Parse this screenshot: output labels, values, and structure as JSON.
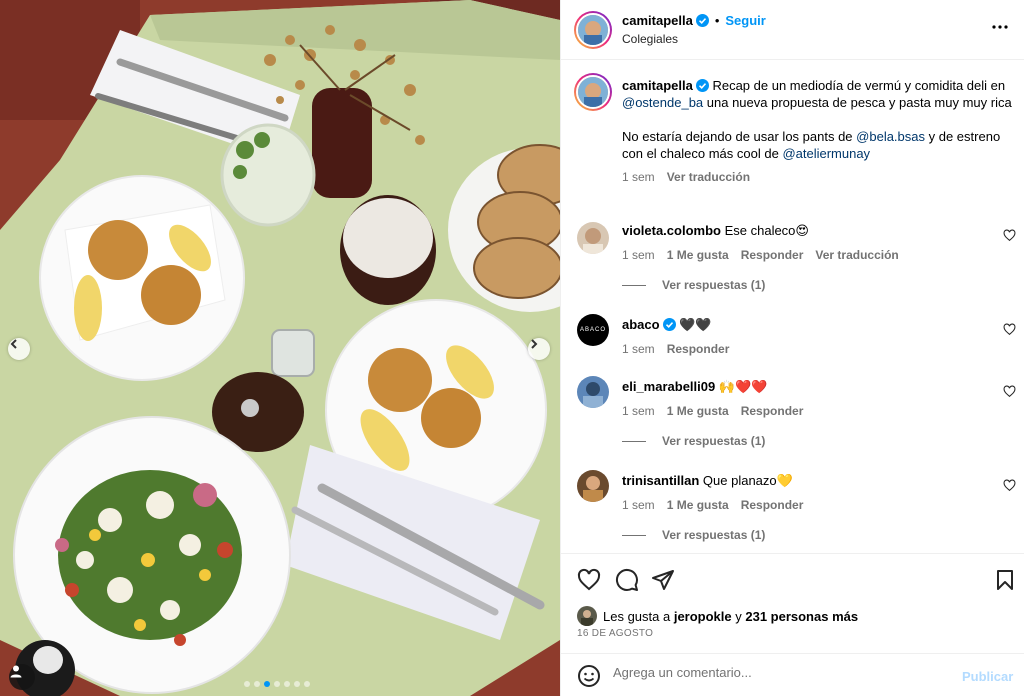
{
  "post": {
    "author": "camitapella",
    "follow_label": "Seguir",
    "separator": "•",
    "location": "Colegiales",
    "more_label": "Más opciones"
  },
  "caption": {
    "author": "camitapella",
    "text_1": "Recap de un mediodía de vermú y comidita deli en ",
    "mention_1": "@ostende_ba",
    "text_2": " una nueva propuesta de pesca y pasta muy muy rica",
    "text_3": "No estaría dejando de usar los pants de ",
    "mention_2": "@bela.bsas",
    "text_4": " y de estreno con el chaleco más cool de ",
    "mention_3": "@ateliermunay",
    "time": "1 sem",
    "translate": "Ver traducción"
  },
  "comments": [
    {
      "user": "violeta.colombo",
      "text": "Ese chaleco😍",
      "time": "1 sem",
      "likes": "1 Me gusta",
      "reply": "Responder",
      "translate": "Ver traducción",
      "replies": "Ver respuestas (1)"
    },
    {
      "user": "abaco",
      "text": "🖤🖤",
      "time": "1 sem",
      "reply": "Responder",
      "avatar_text": "ABACO"
    },
    {
      "user": "eli_marabelli09",
      "text": "🙌❤️❤️",
      "time": "1 sem",
      "likes": "1 Me gusta",
      "reply": "Responder",
      "replies": "Ver respuestas (1)"
    },
    {
      "user": "trinisantillan",
      "text": "Que planazo💛",
      "time": "1 sem",
      "likes": "1 Me gusta",
      "reply": "Responder",
      "replies": "Ver respuestas (1)"
    }
  ],
  "likes": {
    "prefix": "Les gusta a ",
    "user": "jeropokle",
    "middle": " y ",
    "count": "231 personas más"
  },
  "date": "16 DE AGOSTO",
  "comment_input": {
    "placeholder": "Agrega un comentario...",
    "publish": "Publicar"
  },
  "carousel": {
    "slides": 7,
    "active": 2
  },
  "colors": {
    "accent": "#0095f6",
    "mention": "#00376b",
    "secondary": "#737373",
    "table": "#c9d6a3"
  }
}
